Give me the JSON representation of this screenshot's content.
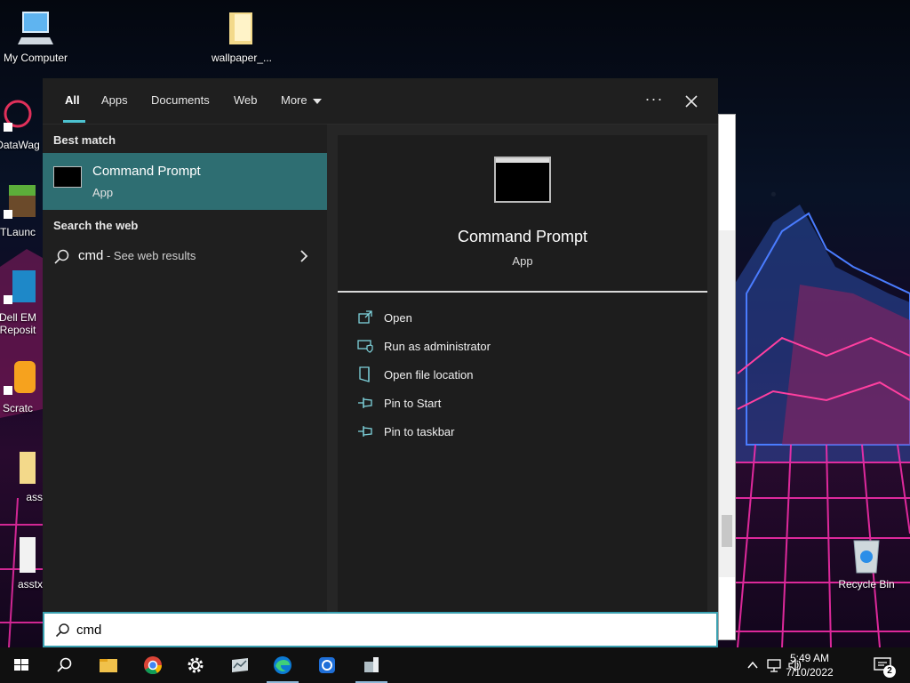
{
  "desktop": {
    "icons": [
      {
        "label": "My Computer"
      },
      {
        "label": "wallpaper_..."
      },
      {
        "label": "DataWag"
      },
      {
        "label": "TLaunc"
      },
      {
        "label": "Dell EM Reposit"
      },
      {
        "label": "Scratc"
      },
      {
        "label": "ass"
      },
      {
        "label": "asstx"
      },
      {
        "label": "Recycle Bin"
      }
    ]
  },
  "search": {
    "tabs": [
      {
        "label": "All"
      },
      {
        "label": "Apps"
      },
      {
        "label": "Documents"
      },
      {
        "label": "Web"
      },
      {
        "label": "More"
      }
    ],
    "ellipsis_label": "···",
    "best_match_title": "Best match",
    "best_match": {
      "name": "Command Prompt",
      "kind": "App"
    },
    "web_title": "Search the web",
    "web_result": {
      "query": "cmd",
      "suffix": " - See web results"
    },
    "preview": {
      "name": "Command Prompt",
      "kind": "App"
    },
    "actions": [
      {
        "label": "Open",
        "icon": "open-icon"
      },
      {
        "label": "Run as administrator",
        "icon": "shield-icon"
      },
      {
        "label": "Open file location",
        "icon": "file-location-icon"
      },
      {
        "label": "Pin to Start",
        "icon": "pin-icon"
      },
      {
        "label": "Pin to taskbar",
        "icon": "pin-icon"
      }
    ],
    "query": "cmd"
  },
  "taskbar": {
    "time": "5:49 AM",
    "date": "7/10/2022",
    "notifications": "2"
  },
  "colors": {
    "accent": "#4cc2d0",
    "selected_row": "#2e6e72",
    "panel_bg": "#1f1f1f"
  }
}
